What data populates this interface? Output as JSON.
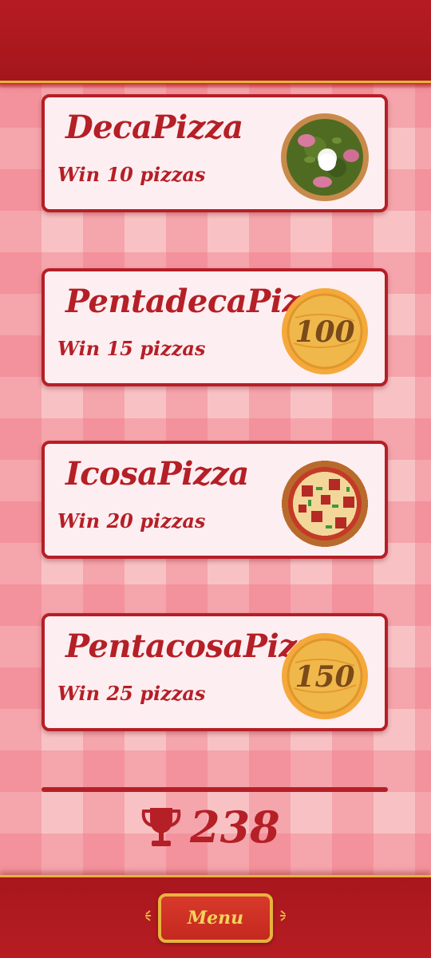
{
  "achievements": [
    {
      "title": "DecaPizza",
      "subtitle": "Win 10 pizzas",
      "reward_icon": "pesto-pizza-icon"
    },
    {
      "title": "PentadecaPizza",
      "subtitle": "Win 15 pizzas",
      "reward_icon": "coin-icon",
      "reward_value": "100"
    },
    {
      "title": "IcosaPizza",
      "subtitle": "Win 20 pizzas",
      "reward_icon": "pixel-pizza-icon"
    },
    {
      "title": "PentacosaPizza",
      "subtitle": "Win 25 pizzas",
      "reward_icon": "coin-icon",
      "reward_value": "150"
    }
  ],
  "score": {
    "icon": "trophy-icon",
    "value": "238"
  },
  "menu_button": {
    "label": "Menu"
  },
  "colors": {
    "bar_red": "#a4161c",
    "text_red": "#b51f26",
    "card_bg": "#fdeef1",
    "gold": "#e8b33d",
    "checker_pink": "#f8c2c5"
  }
}
